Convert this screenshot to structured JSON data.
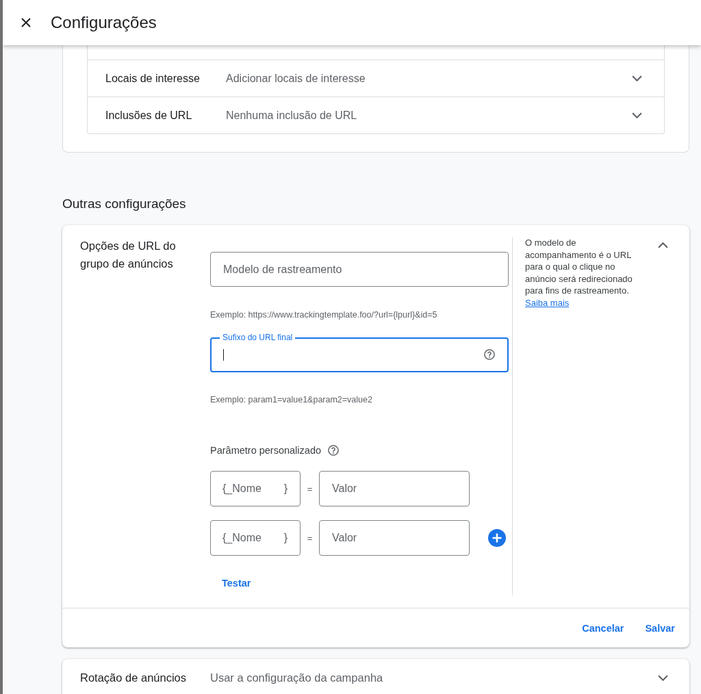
{
  "header": {
    "title": "Configurações"
  },
  "targeting": {
    "rows": [
      {
        "label": "Locais de interesse",
        "value": "Adicionar locais de interesse",
        "expanded": false
      },
      {
        "label": "Inclusões de URL",
        "value": "Nenhuma inclusão de URL",
        "expanded": false
      }
    ]
  },
  "section_heading": "Outras configurações",
  "url_options": {
    "title": "Opções de URL do grupo de anúncios",
    "expanded": true,
    "tracking_template": {
      "placeholder": "Modelo de rastreamento",
      "focused": false,
      "example": "Exemplo: https://www.trackingtemplate.foo/?url={lpurl}&id=5"
    },
    "final_url_suffix": {
      "label": "Sufixo do URL final",
      "focused": true,
      "example": "Exemplo: param1=value1&param2=value2"
    },
    "custom_parameter": {
      "label": "Parâmetro personalizado",
      "rows": [
        {
          "name": {
            "prefix": "{",
            "placeholder": "_Nome",
            "suffix": "}"
          },
          "operator": "=",
          "value": {
            "placeholder": "Valor"
          }
        },
        {
          "name": {
            "prefix": "{",
            "placeholder": "_Nome",
            "suffix": "}"
          },
          "operator": "=",
          "value": {
            "placeholder": "Valor"
          }
        }
      ]
    },
    "test_link": "Testar",
    "help": {
      "text": "O modelo de acompanhamento é o URL para o qual o clique no anúncio será redirecionado para fins de rastreamento.",
      "link": "Saiba mais"
    },
    "actions": [
      {
        "label": "Cancelar"
      },
      {
        "label": "Salvar"
      }
    ]
  },
  "ad_rotation": {
    "label": "Rotação de anúncios",
    "value": "Usar a configuração da campanha",
    "expanded": false
  }
}
